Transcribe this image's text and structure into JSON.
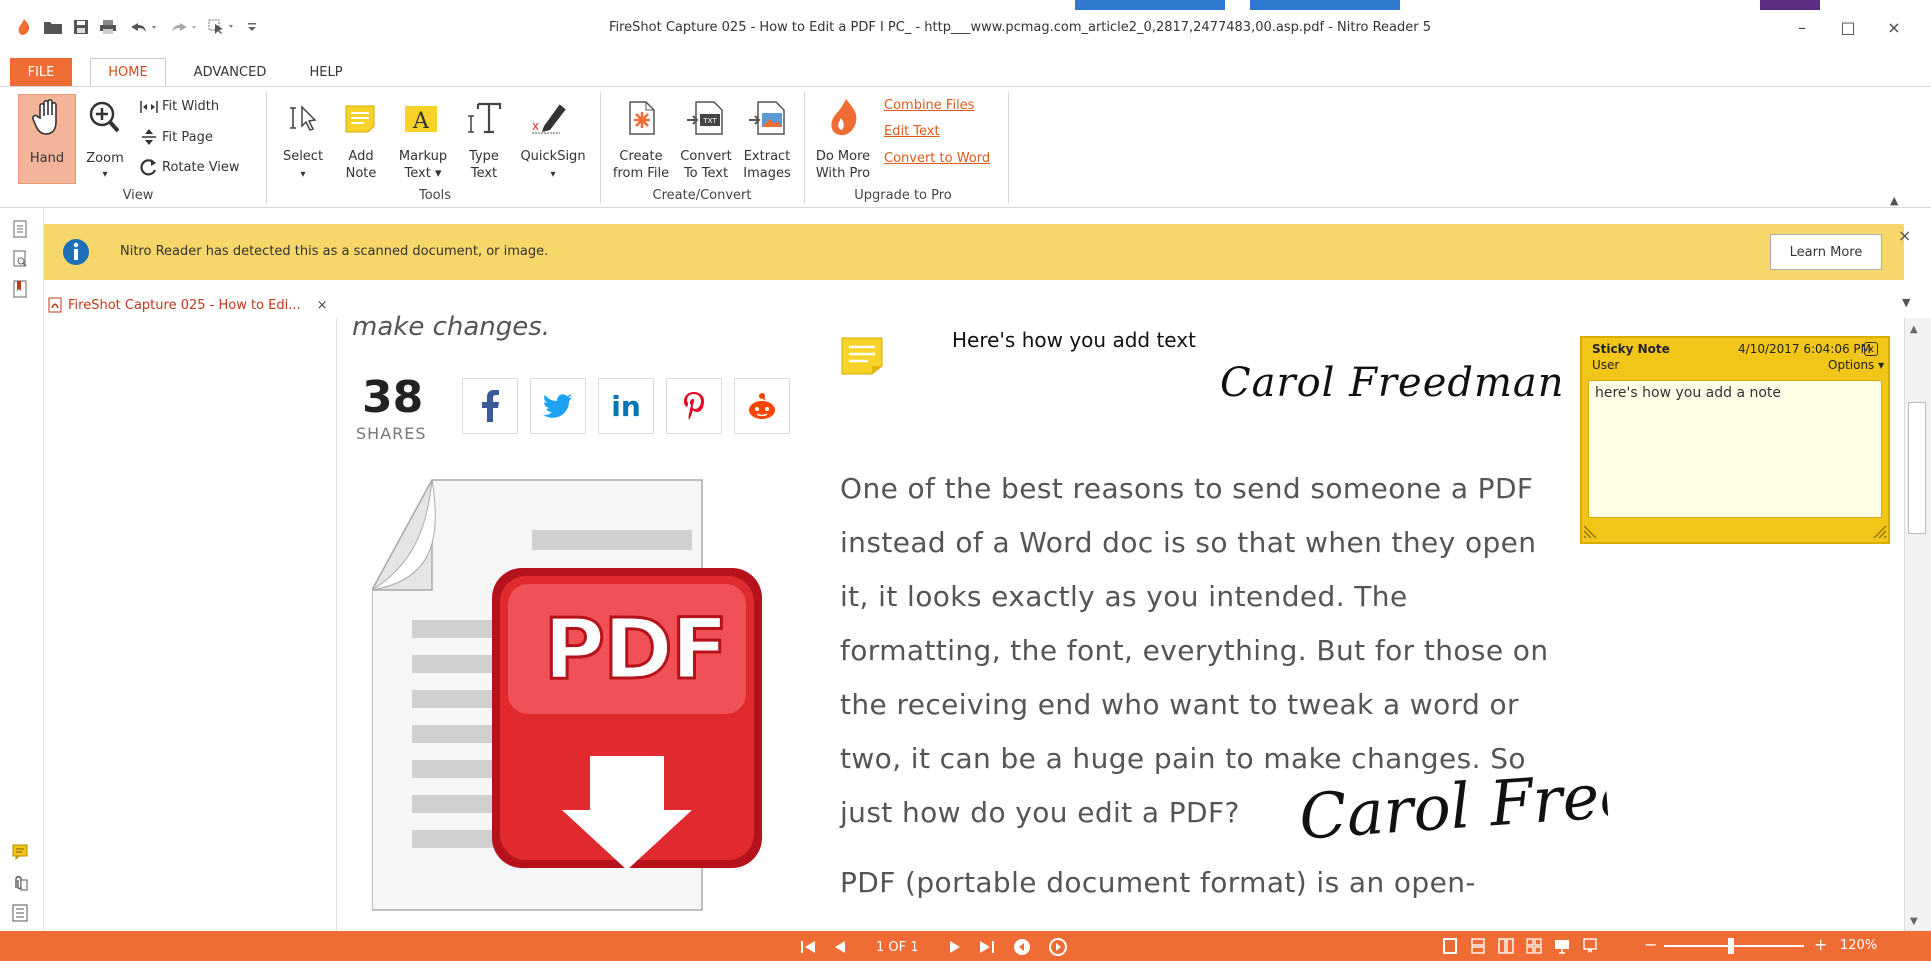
{
  "window": {
    "title": "FireShot Capture 025 - How to Edit a PDF I PC_ - http___www.pcmag.com_article2_0,2817,2477483,00.asp.pdf - Nitro Reader 5",
    "minimize": "–",
    "maximize": "□",
    "close": "×"
  },
  "ribbon_tabs": [
    "FILE",
    "HOME",
    "ADVANCED",
    "HELP"
  ],
  "ribbon": {
    "view": {
      "hand": "Hand",
      "zoom": "Zoom",
      "fit_width": "Fit Width",
      "fit_page": "Fit Page",
      "rotate_view": "Rotate View",
      "group": "View"
    },
    "tools": {
      "select": "Select",
      "add_note_1": "Add",
      "add_note_2": "Note",
      "markup_1": "Markup",
      "markup_2": "Text ▾",
      "type_1": "Type",
      "type_2": "Text",
      "quicksign": "QuickSign",
      "group": "Tools"
    },
    "create": {
      "create_1": "Create",
      "create_2": "from File",
      "convert_1": "Convert",
      "convert_2": "To Text",
      "extract_1": "Extract",
      "extract_2": "Images",
      "group": "Create/Convert"
    },
    "pro": {
      "more_1": "Do More",
      "more_2": "With Pro",
      "combine": "Combine Files",
      "edit_text": "Edit Text",
      "convert_word": "Convert to Word",
      "group": "Upgrade to Pro"
    }
  },
  "notification": {
    "text": "Nitro Reader has detected this as a scanned document, or image.",
    "learn_more": "Learn More",
    "close": "×"
  },
  "doc_tab": {
    "label": "FireShot Capture 025 - How to Edi...",
    "close": "×"
  },
  "page": {
    "cut_text": "make changes.",
    "shares_count": "38",
    "shares_label": "SHARES",
    "pdf_logo": "PDF",
    "added_text": "Here's how you add text",
    "signature_top": "Carol Freedman",
    "signature_bottom": "Carol Free",
    "paragraph": [
      "One of the best reasons to send someone a PDF",
      "instead of a Word doc is so that when they open",
      "it, it looks exactly as you intended. The",
      "formatting, the font, everything. But for those on",
      "the receiving end who want to tweak a word or",
      "two, it can be a huge pain to make changes. So",
      "just how do you edit a PDF?"
    ],
    "paragraph2": "PDF (portable document format) is an open-"
  },
  "sticky_note": {
    "title": "Sticky Note",
    "date": "4/10/2017 6:04:06 PM",
    "user": "User",
    "options": "Options",
    "close": "x",
    "body": "here's how you add a note"
  },
  "status": {
    "page": "1 OF 1",
    "zoom": "120%",
    "minus": "−",
    "plus": "+"
  },
  "colors": {
    "accent": "#ef6c35",
    "notification": "#f7d66a",
    "sticky": "#f2c619",
    "link": "#e05a1a"
  }
}
